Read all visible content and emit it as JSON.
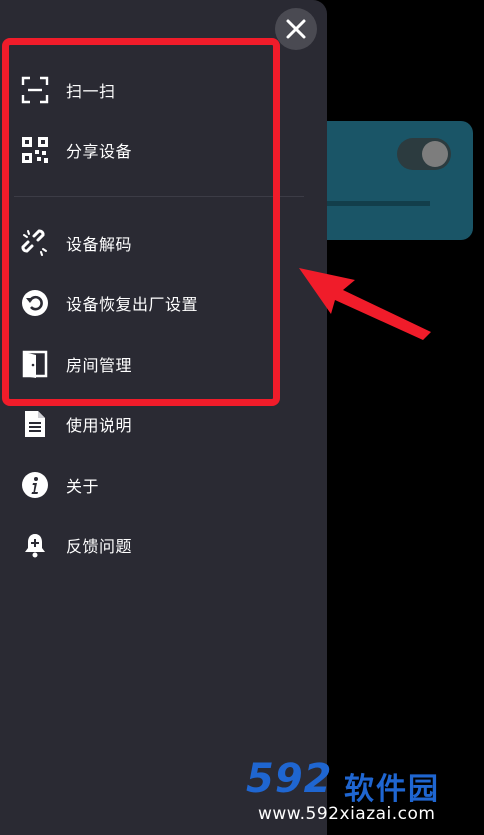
{
  "menu": {
    "items": [
      {
        "label": "扫一扫",
        "icon": "scan-icon"
      },
      {
        "label": "分享设备",
        "icon": "qr-code-icon"
      },
      {
        "label": "设备解码",
        "icon": "unlink-icon"
      },
      {
        "label": "设备恢复出厂设置",
        "icon": "reset-icon"
      },
      {
        "label": "房间管理",
        "icon": "door-icon"
      },
      {
        "label": "使用说明",
        "icon": "document-icon"
      },
      {
        "label": "关于",
        "icon": "info-icon"
      },
      {
        "label": "反馈问题",
        "icon": "bell-icon"
      }
    ]
  },
  "close": {
    "icon": "close-icon"
  },
  "colors": {
    "drawer_bg": "#2a2a33",
    "highlight": "#f01c2a",
    "card": "#1a5567",
    "watermark": "#1f66d1"
  },
  "watermark": {
    "logo_number": "592",
    "logo_text": "软件园",
    "url": "www.592xiazai.com"
  }
}
